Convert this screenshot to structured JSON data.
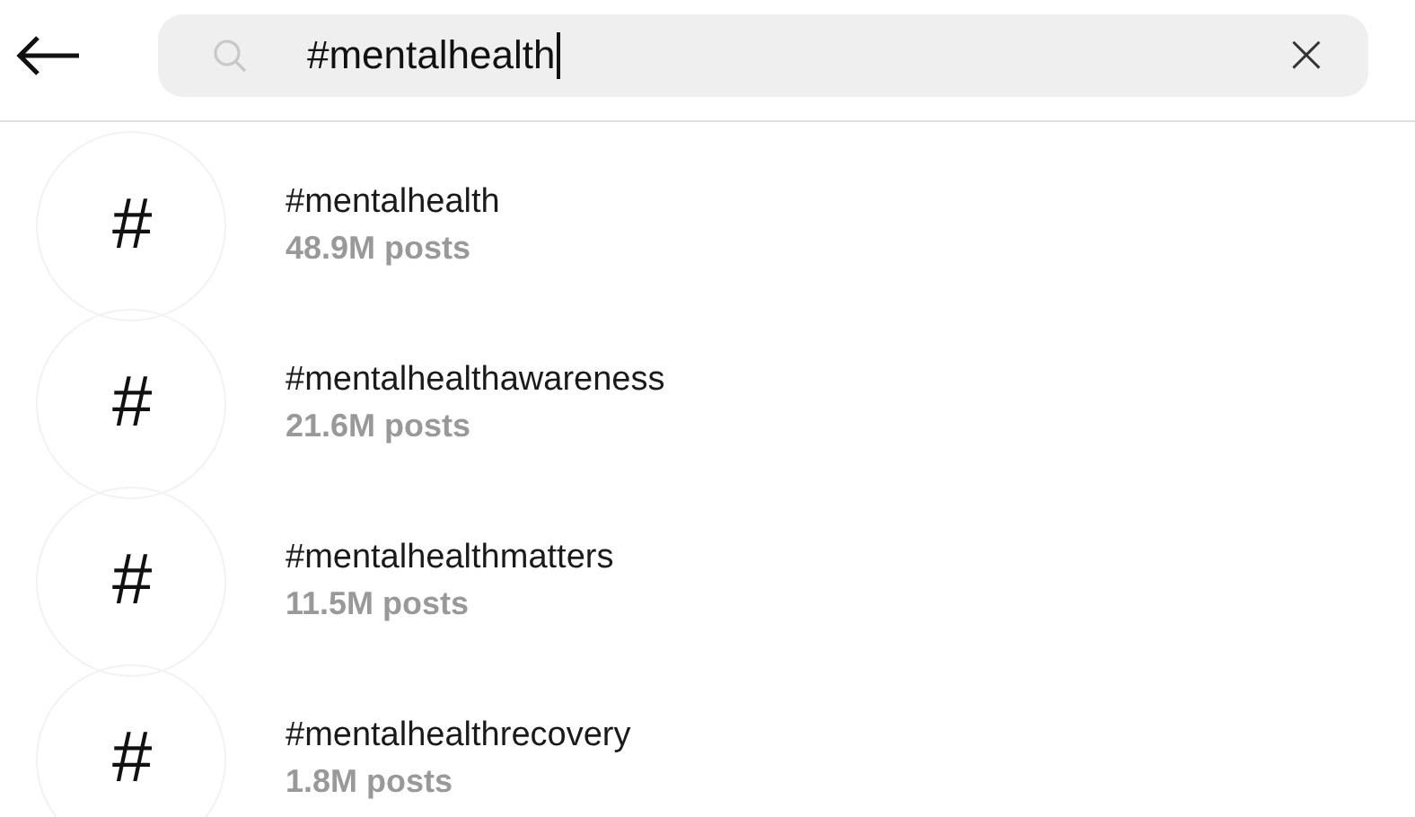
{
  "search": {
    "value": "#mentalhealth",
    "clear_icon": "×"
  },
  "results": [
    {
      "icon": "#",
      "tag": "#mentalhealth",
      "count": "48.9M posts"
    },
    {
      "icon": "#",
      "tag": "#mentalhealthawareness",
      "count": "21.6M posts"
    },
    {
      "icon": "#",
      "tag": "#mentalhealthmatters",
      "count": "11.5M posts"
    },
    {
      "icon": "#",
      "tag": "#mentalhealthrecovery",
      "count": "1.8M posts"
    }
  ]
}
